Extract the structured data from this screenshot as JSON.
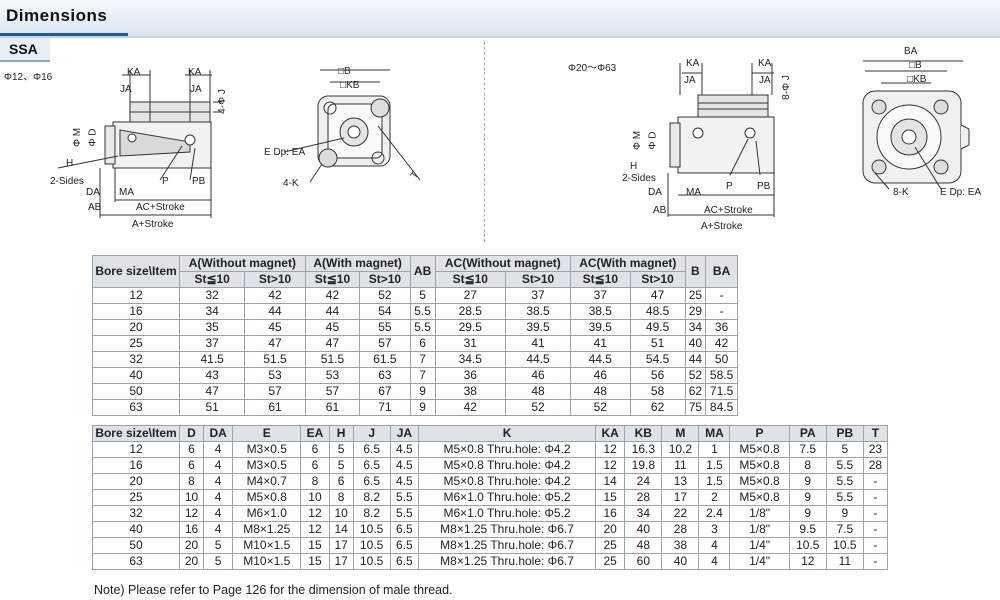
{
  "header": {
    "title": "Dimensions",
    "section": "SSA"
  },
  "left_diagram": {
    "size_label": "Φ12、Φ16",
    "labels": {
      "KA1": "KA",
      "KA2": "KA",
      "JA1": "JA",
      "JA2": "JA",
      "J": "4-Φ J",
      "M": "Φ M",
      "D": "Φ D",
      "H": "H",
      "sides": "2-Sides",
      "DA": "DA",
      "MA": "MA",
      "AB": "AB",
      "P": "P",
      "PB": "PB",
      "AC": "AC+Stroke",
      "A": "A+Stroke",
      "B": "□B",
      "KB": "□KB",
      "EDP": "E Dp: EA",
      "K": "4-K",
      "T": "T"
    }
  },
  "right_diagram": {
    "size_label": "Φ20～Φ63",
    "labels": {
      "KA1": "KA",
      "KA2": "KA",
      "JA1": "JA",
      "JA2": "JA",
      "J": "8-Φ J",
      "M": "Φ M",
      "D": "Φ D",
      "H": "H",
      "sides": "2-Sides",
      "DA": "DA",
      "MA": "MA",
      "AB": "AB",
      "P": "P",
      "PB": "PB",
      "AC": "AC+Stroke",
      "A": "A+Stroke",
      "BA": "BA",
      "B": "□B",
      "KB": "□KB",
      "K": "8-K",
      "EDP": "E Dp: EA"
    }
  },
  "table1": {
    "header_row1": {
      "bore": "Bore size\\Item",
      "a_wo": "A(Without magnet)",
      "a_w": "A(With magnet)",
      "ab": "AB",
      "ac_wo": "AC(Without magnet)",
      "ac_w": "AC(With magnet)",
      "b": "B",
      "ba": "BA"
    },
    "header_row2": [
      "St≦10",
      "St>10",
      "St≦10",
      "St>10",
      "St≦10",
      "St>10",
      "St≦10",
      "St>10"
    ],
    "rows": [
      [
        "12",
        "32",
        "42",
        "42",
        "52",
        "5",
        "27",
        "37",
        "37",
        "47",
        "25",
        "-"
      ],
      [
        "16",
        "34",
        "44",
        "44",
        "54",
        "5.5",
        "28.5",
        "38.5",
        "38.5",
        "48.5",
        "29",
        "-"
      ],
      [
        "20",
        "35",
        "45",
        "45",
        "55",
        "5.5",
        "29.5",
        "39.5",
        "39.5",
        "49.5",
        "34",
        "36"
      ],
      [
        "25",
        "37",
        "47",
        "47",
        "57",
        "6",
        "31",
        "41",
        "41",
        "51",
        "40",
        "42"
      ],
      [
        "32",
        "41.5",
        "51.5",
        "51.5",
        "61.5",
        "7",
        "34.5",
        "44.5",
        "44.5",
        "54.5",
        "44",
        "50"
      ],
      [
        "40",
        "43",
        "53",
        "53",
        "63",
        "7",
        "36",
        "46",
        "46",
        "56",
        "52",
        "58.5"
      ],
      [
        "50",
        "47",
        "57",
        "57",
        "67",
        "9",
        "38",
        "48",
        "48",
        "58",
        "62",
        "71.5"
      ],
      [
        "63",
        "51",
        "61",
        "61",
        "71",
        "9",
        "42",
        "52",
        "52",
        "62",
        "75",
        "84.5"
      ]
    ]
  },
  "table2": {
    "headers": [
      "Bore size\\Item",
      "D",
      "DA",
      "E",
      "EA",
      "H",
      "J",
      "JA",
      "K",
      "KA",
      "KB",
      "M",
      "MA",
      "P",
      "PA",
      "PB",
      "T"
    ],
    "rows": [
      [
        "12",
        "6",
        "4",
        "M3×0.5",
        "6",
        "5",
        "6.5",
        "4.5",
        "M5×0.8 Thru.hole: Φ4.2",
        "12",
        "16.3",
        "10.2",
        "1",
        "M5×0.8",
        "7.5",
        "5",
        "23"
      ],
      [
        "16",
        "6",
        "4",
        "M3×0.5",
        "6",
        "5",
        "6.5",
        "4.5",
        "M5×0.8 Thru.hole: Φ4.2",
        "12",
        "19.8",
        "11",
        "1.5",
        "M5×0.8",
        "8",
        "5.5",
        "28"
      ],
      [
        "20",
        "8",
        "4",
        "M4×0.7",
        "8",
        "6",
        "6.5",
        "4.5",
        "M5×0.8 Thru.hole: Φ4.2",
        "14",
        "24",
        "13",
        "1.5",
        "M5×0.8",
        "9",
        "5.5",
        "-"
      ],
      [
        "25",
        "10",
        "4",
        "M5×0.8",
        "10",
        "8",
        "8.2",
        "5.5",
        "M6×1.0 Thru.hole: Φ5.2",
        "15",
        "28",
        "17",
        "2",
        "M5×0.8",
        "9",
        "5.5",
        "-"
      ],
      [
        "32",
        "12",
        "4",
        "M6×1.0",
        "12",
        "10",
        "8.2",
        "5.5",
        "M6×1.0 Thru.hole: Φ5.2",
        "16",
        "34",
        "22",
        "2.4",
        "1/8\"",
        "9",
        "9",
        "-"
      ],
      [
        "40",
        "16",
        "4",
        "M8×1.25",
        "12",
        "14",
        "10.5",
        "6.5",
        "M8×1.25 Thru.hole: Φ6.7",
        "20",
        "40",
        "28",
        "3",
        "1/8\"",
        "9.5",
        "7.5",
        "-"
      ],
      [
        "50",
        "20",
        "5",
        "M10×1.5",
        "15",
        "17",
        "10.5",
        "6.5",
        "M8×1.25 Thru.hole: Φ6.7",
        "25",
        "48",
        "38",
        "4",
        "1/4\"",
        "10.5",
        "10.5",
        "-"
      ],
      [
        "63",
        "20",
        "5",
        "M10×1.5",
        "15",
        "17",
        "10.5",
        "6.5",
        "M8×1.25 Thru.hole: Φ6.7",
        "25",
        "60",
        "40",
        "4",
        "1/4\"",
        "12",
        "11",
        "-"
      ]
    ]
  },
  "note": "Note) Please refer to Page 126 for the dimension of male thread."
}
